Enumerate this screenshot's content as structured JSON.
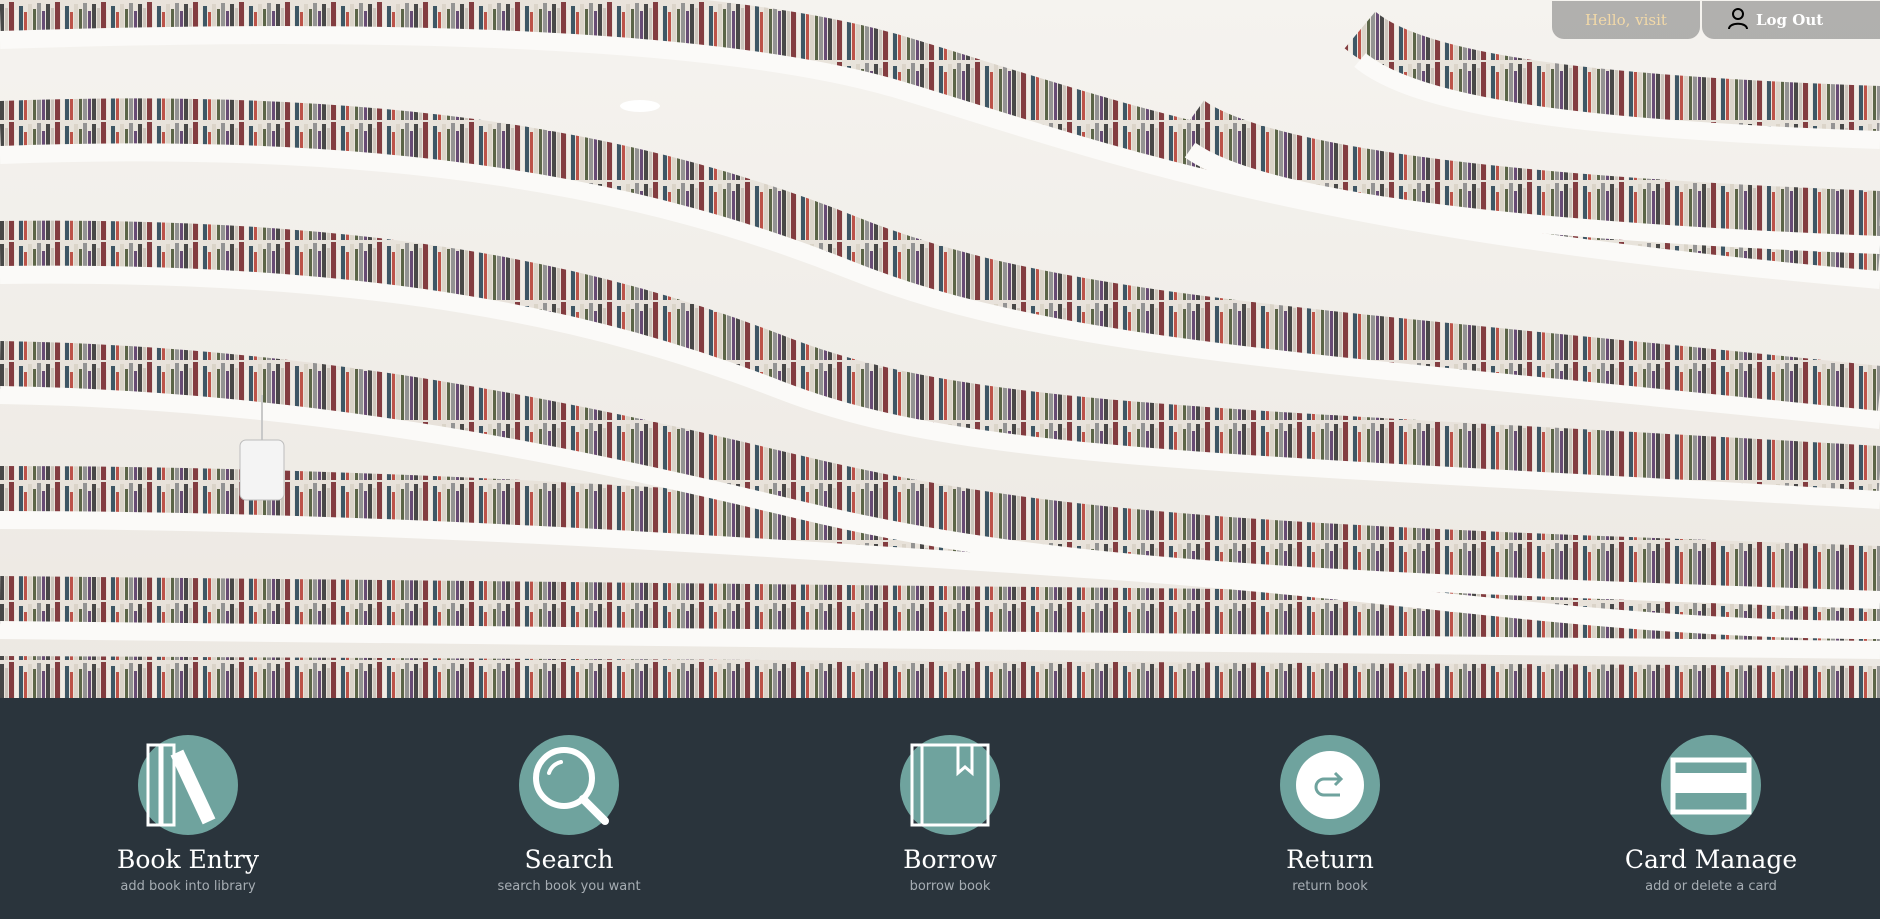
{
  "header": {
    "greeting": "Hello, visit",
    "logout_label": "Log Out",
    "logout_icon": "user-icon"
  },
  "hero": {
    "image_subject": "library-bookshelves-photo"
  },
  "features": [
    {
      "title": "Book Entry",
      "subtitle": "add book into library",
      "icon": "books-icon"
    },
    {
      "title": "Search",
      "subtitle": "search book you want",
      "icon": "magnifier-icon"
    },
    {
      "title": "Borrow",
      "subtitle": "borrow book",
      "icon": "bookmarked-book-icon"
    },
    {
      "title": "Return",
      "subtitle": "return book",
      "icon": "return-arrow-icon"
    },
    {
      "title": "Card Manage",
      "subtitle": "add or delete a card",
      "icon": "card-icon"
    }
  ],
  "colors": {
    "footer_bg": "#2a343c",
    "icon_circle": "#6fa39e",
    "greeting_text": "#f2d9a8",
    "subtitle_text": "#a6adb3"
  }
}
